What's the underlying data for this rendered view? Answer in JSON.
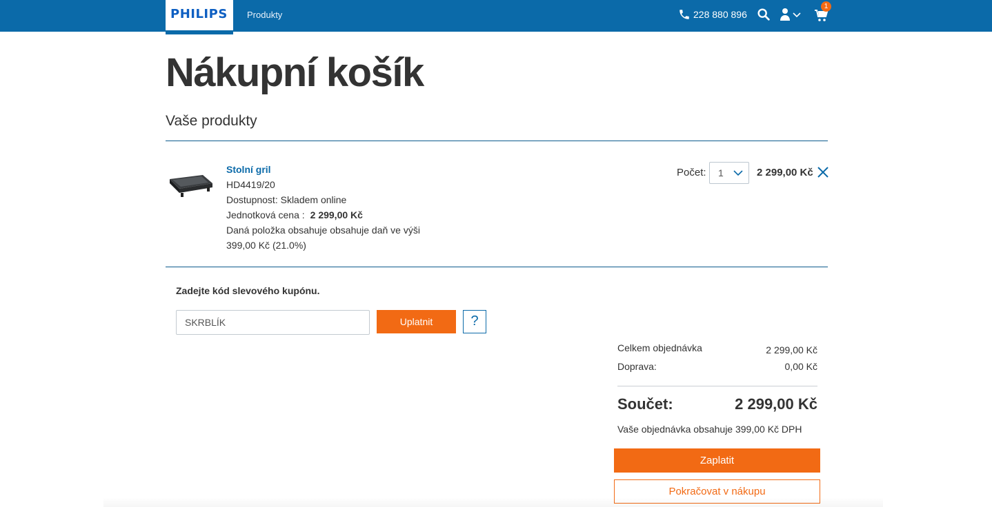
{
  "header": {
    "logo": "PHILIPS",
    "nav_products": "Produkty",
    "phone": "228 880 896",
    "cart_count": "1"
  },
  "page": {
    "title": "Nákupní košík",
    "section_title": "Vaše produkty"
  },
  "product": {
    "name": "Stolní gril",
    "model": "HD4419/20",
    "availability": "Dostupnost: Skladem online",
    "unit_price_label": "Jednotková cena :",
    "unit_price": "2 299,00 Kč",
    "tax_note_1": "Daná položka obsahuje obsahuje daň ve výši",
    "tax_note_2": "399,00 Kč (21.0%)",
    "quantity_label": "Počet:",
    "quantity": "1",
    "line_total": "2 299,00 Kč"
  },
  "coupon": {
    "label": "Zadejte kód slevového kupónu.",
    "value": "SKRBLÍK",
    "apply_label": "Uplatnit",
    "help_label": "?"
  },
  "summary": {
    "order_total_label": "Celkem objednávka",
    "order_total": "2 299,00 Kč",
    "shipping_label": "Doprava:",
    "shipping": "0,00 Kč",
    "total_label": "Součet:",
    "total": "2 299,00 Kč",
    "vat_note": "Vaše objednávka obsahuje 399,00 Kč DPH",
    "pay_label": "Zaplatit",
    "continue_label": "Pokračovat v nákupu"
  },
  "colors": {
    "brand_blue": "#0b6aa9",
    "accent_orange": "#f26a14"
  }
}
